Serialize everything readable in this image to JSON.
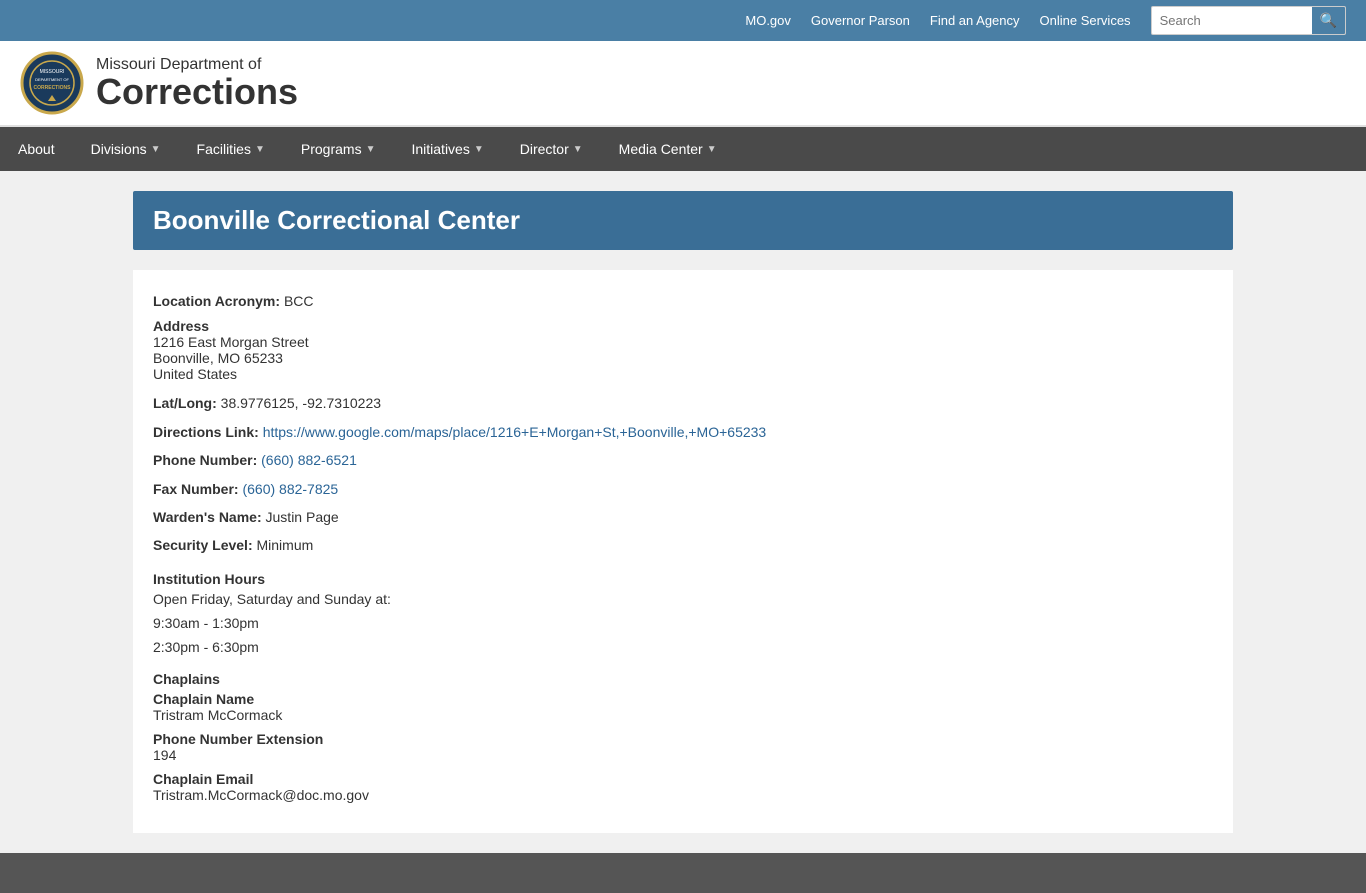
{
  "topbar": {
    "links": [
      {
        "label": "MO.gov",
        "href": "#"
      },
      {
        "label": "Governor Parson",
        "href": "#"
      },
      {
        "label": "Find an Agency",
        "href": "#"
      },
      {
        "label": "Online Services",
        "href": "#"
      }
    ],
    "search_placeholder": "Search"
  },
  "header": {
    "dept_line": "Missouri Department of",
    "brand": "Corrections"
  },
  "nav": {
    "items": [
      {
        "label": "About",
        "has_dropdown": false
      },
      {
        "label": "Divisions",
        "has_dropdown": true
      },
      {
        "label": "Facilities",
        "has_dropdown": true
      },
      {
        "label": "Programs",
        "has_dropdown": true
      },
      {
        "label": "Initiatives",
        "has_dropdown": true
      },
      {
        "label": "Director",
        "has_dropdown": true
      },
      {
        "label": "Media Center",
        "has_dropdown": true
      }
    ]
  },
  "page": {
    "title": "Boonville Correctional Center",
    "location_acronym_label": "Location Acronym:",
    "location_acronym_value": "BCC",
    "address_label": "Address",
    "address_line1": "1216 East Morgan Street",
    "address_line2": "Boonville, MO 65233",
    "address_line3": "United States",
    "latlong_label": "Lat/Long:",
    "latlong_value": "38.9776125, -92.7310223",
    "directions_label": "Directions Link:",
    "directions_url": "https://www.google.com/maps/place/1216+E+Morgan+St,+Boonville,+MO+65233",
    "directions_display": "https://www.google.com/maps/place/1216+E+Morgan+St,+Boonville,+MO+65233",
    "phone_label": "Phone Number:",
    "phone_value": "(660) 882-6521",
    "fax_label": "Fax Number:",
    "fax_value": "(660) 882-7825",
    "warden_label": "Warden's Name:",
    "warden_value": "Justin Page",
    "security_label": "Security Level:",
    "security_value": "Minimum",
    "institution_hours_label": "Institution Hours",
    "hours_intro": "Open Friday, Saturday and Sunday at:",
    "hours_morning": "9:30am - 1:30pm",
    "hours_afternoon": "2:30pm - 6:30pm",
    "chaplains_label": "Chaplains",
    "chaplain_name_label": "Chaplain Name",
    "chaplain_name_value": "Tristram McCormack",
    "chaplain_phone_label": "Phone Number Extension",
    "chaplain_phone_value": "194",
    "chaplain_email_label": "Chaplain Email",
    "chaplain_email_value": "Tristram.McCormack@doc.mo.gov"
  }
}
